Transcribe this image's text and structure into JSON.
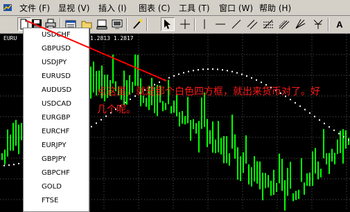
{
  "menubar": {
    "items": [
      "文件 (F)",
      "显视 (V)",
      "插入 (I)",
      "图表 (C)",
      "工具 (T)",
      "窗口 (W)",
      "帮助 (H)"
    ]
  },
  "toolbar": {
    "text_tool_label": "A"
  },
  "chart": {
    "symbol_prefix": "EURU",
    "quote": "1.2813 1.2817",
    "colors": {
      "background": "#000000",
      "candle": "#00ff00",
      "grid": "#5a5a5a",
      "dots": "#ffffff"
    }
  },
  "symbol_dropdown": {
    "items": [
      "USDCHF",
      "GBPUSD",
      "USDJPY",
      "EURUSD",
      "AUDUSD",
      "USDCAD",
      "EURGBP",
      "EURCHF",
      "EURJPY",
      "GBPJPY",
      "GBPCHF",
      "GOLD",
      "FTSE"
    ]
  },
  "annotation": {
    "text": "点这里，就是那个白色四方框，就出来货币对了。好几个呢。",
    "color": "#ff1a1a"
  }
}
